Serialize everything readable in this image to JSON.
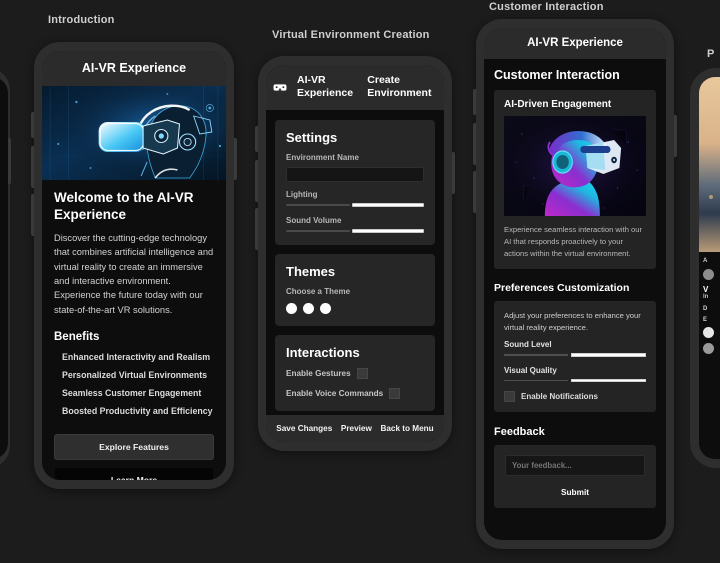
{
  "meta": {
    "background": "#1c1c1c",
    "accent": "#ffffff"
  },
  "screens": [
    {
      "label": "Introduction",
      "appbar_title": "AI-VR Experience",
      "title": "Welcome to the AI-VR Experience",
      "paragraph": "Discover the cutting-edge technology that combines artificial intelligence and virtual reality to create an immersive and interactive environment. Experience the future today with our state-of-the-art VR solutions.",
      "benefits_heading": "Benefits",
      "benefits": [
        "Enhanced Interactivity and Realism",
        "Personalized Virtual Environments",
        "Seamless Customer Engagement",
        "Boosted Productivity and Efficiency"
      ],
      "primary_button": "Explore Features",
      "secondary_button": "Learn More",
      "hero_icon": "vr-headset-hero-image"
    },
    {
      "label": "Virtual Environment Creation",
      "appbar_brand": "AI-VR Experience",
      "appbar_section": "Create Environment",
      "appbar_icon": "vr-goggles-icon",
      "settings": {
        "heading": "Settings",
        "name_label": "Environment Name",
        "name_value": "",
        "name_placeholder": "",
        "lighting_label": "Lighting",
        "sound_label": "Sound Volume"
      },
      "themes": {
        "heading": "Themes",
        "subtitle": "Choose a Theme",
        "swatches": [
          "#ffffff",
          "#ffffff",
          "#ffffff"
        ]
      },
      "interactions": {
        "heading": "Interactions",
        "gestures_label": "Enable Gestures",
        "voice_label": "Enable Voice Commands"
      },
      "footer": [
        "Save Changes",
        "Preview",
        "Back to Menu"
      ]
    },
    {
      "label": "Customer Interaction",
      "appbar_title": "AI-VR Experience",
      "heading": "Customer Interaction",
      "engagement": {
        "heading": "AI-Driven Engagement",
        "caption": "Experience seamless interaction with our AI that responds proactively to your actions within the virtual environment.",
        "image_icon": "ai-avatar-vr-headset-image"
      },
      "preferences": {
        "heading": "Preferences Customization",
        "note": "Adjust your preferences to enhance your virtual reality experience.",
        "sound_label": "Sound Level",
        "visual_label": "Visual Quality",
        "notifications_label": "Enable Notifications"
      },
      "feedback": {
        "heading": "Feedback",
        "placeholder": "Your feedback...",
        "value": "",
        "submit": "Submit"
      }
    },
    {
      "label": "P",
      "appbar_title": "",
      "note": "partially visible phone at right edge"
    }
  ]
}
